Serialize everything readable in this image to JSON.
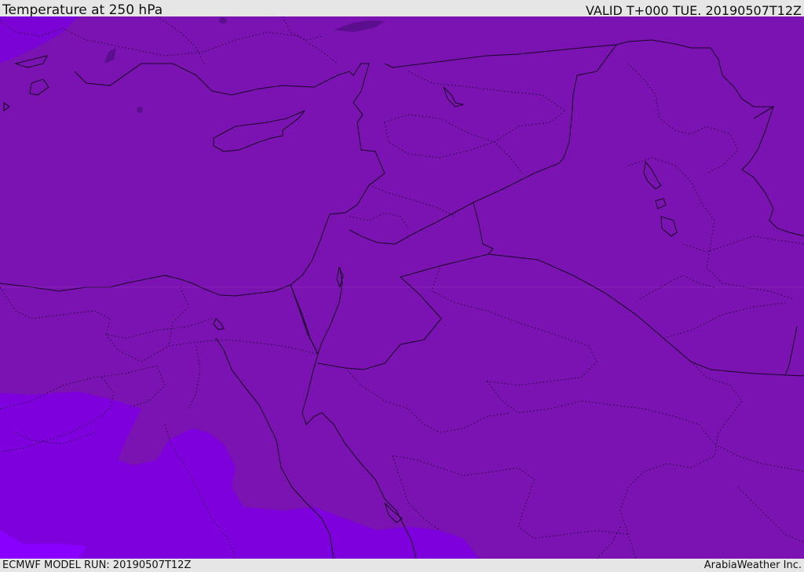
{
  "header": {
    "title": "Temperature at 250 hPa",
    "valid": "VALID T+000 TUE. 20190507T12Z"
  },
  "footer": {
    "model_run": "ECMWF MODEL RUN: 20190507T12Z",
    "credit": "ArabiaWeather Inc."
  },
  "colors": {
    "base_fill": "#7b12b2",
    "colder_fill": "#7d00dd",
    "coldest_fill": "#8a00ff",
    "cold_spot": "#5b0f8f",
    "boundary": "#1a0628"
  }
}
